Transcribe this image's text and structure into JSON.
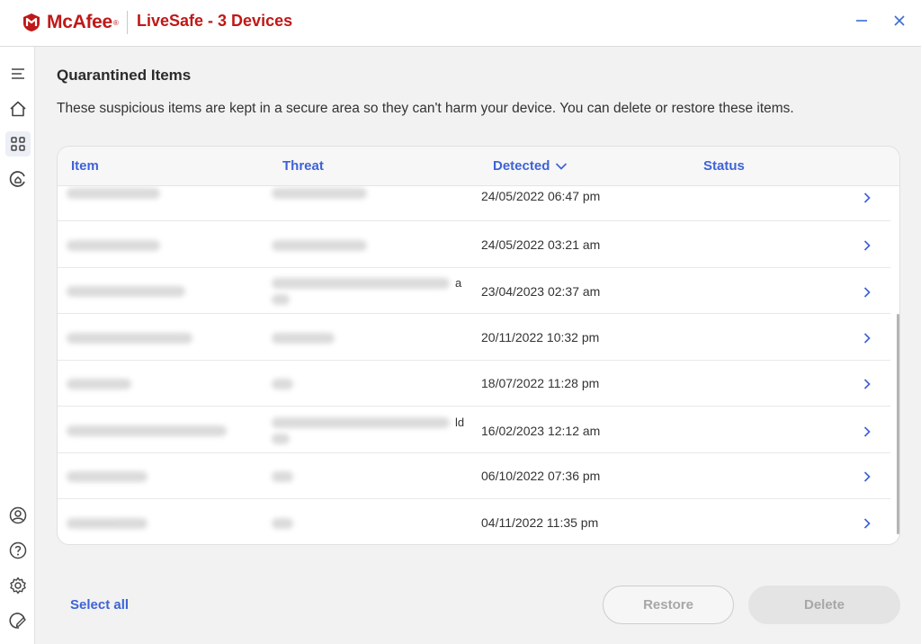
{
  "app": {
    "brand": "McAfee",
    "title": "LiveSafe - 3 Devices",
    "brand_color": "#c01818",
    "accent_color": "#3e63d6"
  },
  "window": {
    "minimize_icon": "minimize-icon",
    "close_icon": "close-icon"
  },
  "sidebar": {
    "items": [
      {
        "name": "menu",
        "icon": "menu-icon"
      },
      {
        "name": "home",
        "icon": "home-icon"
      },
      {
        "name": "apps",
        "icon": "grid-icon",
        "active": true
      },
      {
        "name": "protection",
        "icon": "protection-icon"
      },
      {
        "name": "account",
        "icon": "account-icon"
      },
      {
        "name": "help",
        "icon": "help-icon"
      },
      {
        "name": "settings",
        "icon": "gear-icon"
      },
      {
        "name": "feedback",
        "icon": "feedback-icon"
      }
    ]
  },
  "page": {
    "title": "Quarantined Items",
    "description": "These suspicious items are kept in a secure area so they can't harm your device. You can delete or restore these items."
  },
  "table": {
    "columns": [
      "Item",
      "Threat",
      "Detected",
      "Status"
    ],
    "sort_column": "Detected",
    "sort_direction": "descending",
    "rows": [
      {
        "item": "",
        "threat": "",
        "detected": "24/05/2022 06:47 pm",
        "status": "",
        "fragment": ""
      },
      {
        "item": "",
        "threat": "",
        "detected": "24/05/2022 03:21 am",
        "status": "",
        "fragment": ""
      },
      {
        "item": "",
        "threat": "",
        "detected": "23/04/2023 02:37 am",
        "status": "",
        "fragment": "a"
      },
      {
        "item": "",
        "threat": "",
        "detected": "20/11/2022 10:32 pm",
        "status": "",
        "fragment": ""
      },
      {
        "item": "",
        "threat": "",
        "detected": "18/07/2022 11:28 pm",
        "status": "",
        "fragment": ""
      },
      {
        "item": "",
        "threat": "",
        "detected": "16/02/2023 12:12 am",
        "status": "",
        "fragment": "ld"
      },
      {
        "item": "",
        "threat": "",
        "detected": "06/10/2022 07:36 pm",
        "status": "",
        "fragment": ""
      },
      {
        "item": "",
        "threat": "",
        "detected": "04/11/2022 11:35 pm",
        "status": "",
        "fragment": ""
      }
    ]
  },
  "footer": {
    "select_all": "Select all",
    "restore": "Restore",
    "delete": "Delete"
  }
}
